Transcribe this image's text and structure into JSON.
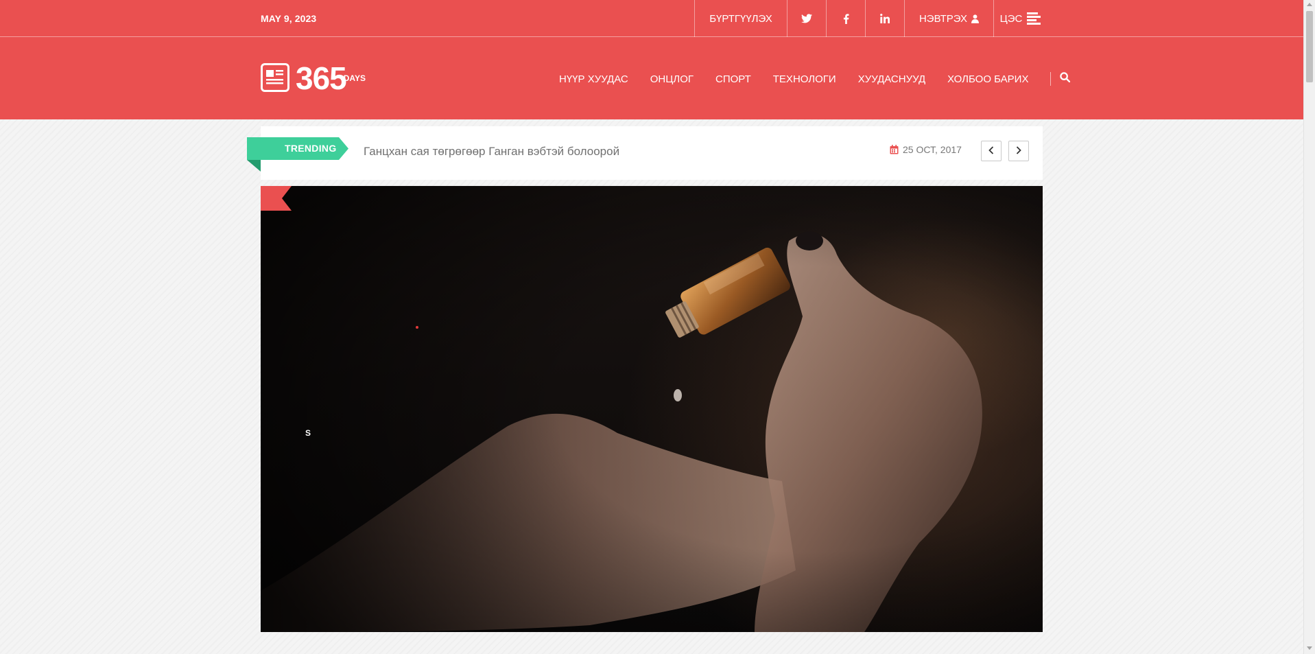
{
  "topbar": {
    "date": "MAY 9, 2023",
    "register_label": "БҮРТГҮҮЛЭХ",
    "social": [
      {
        "name": "twitter-icon"
      },
      {
        "name": "facebook-icon"
      },
      {
        "name": "linkedin-icon"
      }
    ],
    "login_label": "НЭВТРЭХ",
    "menu_label": "ЦЭС"
  },
  "logo": {
    "number": "365",
    "suffix": "DAYS"
  },
  "nav": {
    "items": [
      {
        "label": "НҮҮР ХУУДАС"
      },
      {
        "label": "ОНЦЛОГ"
      },
      {
        "label": "СПОРТ"
      },
      {
        "label": "ТЕХНОЛОГИ"
      },
      {
        "label": "ХУУДАСНУУД"
      },
      {
        "label": "ХОЛБОО БАРИХ"
      }
    ]
  },
  "trending": {
    "label": "TRENDING",
    "title": "Ганцхан сая төгрөгөөр Ганган вэбтэй болоорой",
    "date": "25 ОСТ, 2017"
  },
  "hero": {
    "tag_label": "S"
  },
  "colors": {
    "brand": "#ea5050",
    "trending": "#3ecf9a",
    "trending_dark": "#249c6e"
  }
}
